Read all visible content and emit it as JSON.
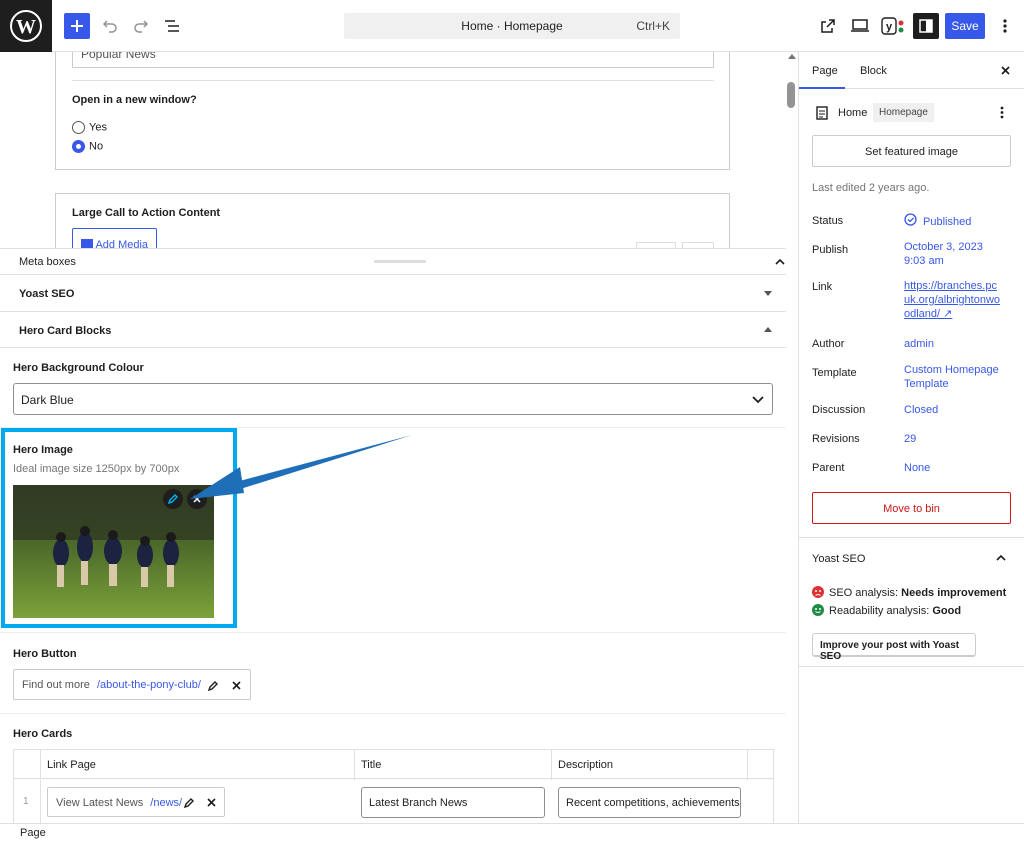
{
  "topbar": {
    "command_title": "Home · Homepage",
    "command_shortcut": "Ctrl+K",
    "save_label": "Save"
  },
  "canvas": {
    "popular_news_value": "Popular News",
    "open_new_window_label": "Open in a new window?",
    "radio_yes": "Yes",
    "radio_no": "No",
    "large_cta_label": "Large Call to Action Content",
    "add_media_label": "Add Media"
  },
  "meta": {
    "header": "Meta boxes",
    "yoast": "Yoast SEO",
    "hero_cards_blocks": "Hero Card Blocks",
    "bg_colour_label": "Hero Background Colour",
    "bg_colour_value": "Dark Blue",
    "hero_image_label": "Hero Image",
    "hero_image_hint": "Ideal image size 1250px by 700px",
    "hero_button_label": "Hero Button",
    "hero_button_text": "Find out more",
    "hero_button_url": "/about-the-pony-club/",
    "hero_cards_label": "Hero Cards",
    "table_headers": [
      "Link Page",
      "Title",
      "Description"
    ],
    "row1": {
      "index": "1",
      "link_text": "View Latest News",
      "link_url": "/news/",
      "title": "Latest Branch News",
      "description": "Recent competitions, achievements"
    }
  },
  "sidebar": {
    "tab_page": "Page",
    "tab_block": "Block",
    "doc_title": "Home",
    "doc_badge": "Homepage",
    "featured_image": "Set featured image",
    "last_edited": "Last edited 2 years ago.",
    "rows": [
      {
        "label": "Status",
        "value": "Published"
      },
      {
        "label": "Publish",
        "value": "October 3, 2023 9:03 am"
      },
      {
        "label": "Link",
        "value": "https://branches.pcuk.org/albrightonwoodland/ ↗"
      },
      {
        "label": "Author",
        "value": "admin"
      },
      {
        "label": "Template",
        "value": "Custom Homepage Template"
      },
      {
        "label": "Discussion",
        "value": "Closed"
      },
      {
        "label": "Revisions",
        "value": "29"
      },
      {
        "label": "Parent",
        "value": "None"
      }
    ],
    "move_to_bin": "Move to bin",
    "yoast_title": "Yoast SEO",
    "seo_prefix": "SEO analysis: ",
    "seo_value": "Needs improvement",
    "readability_prefix": "Readability analysis: ",
    "readability_value": "Good",
    "improve_button": "Improve your post with Yoast SEO"
  },
  "footer": {
    "breadcrumb": "Page"
  },
  "colors": {
    "accent": "#3858e9",
    "highlight": "#00a8f0",
    "arrow": "#1e6fb8",
    "danger": "#cc1818"
  }
}
